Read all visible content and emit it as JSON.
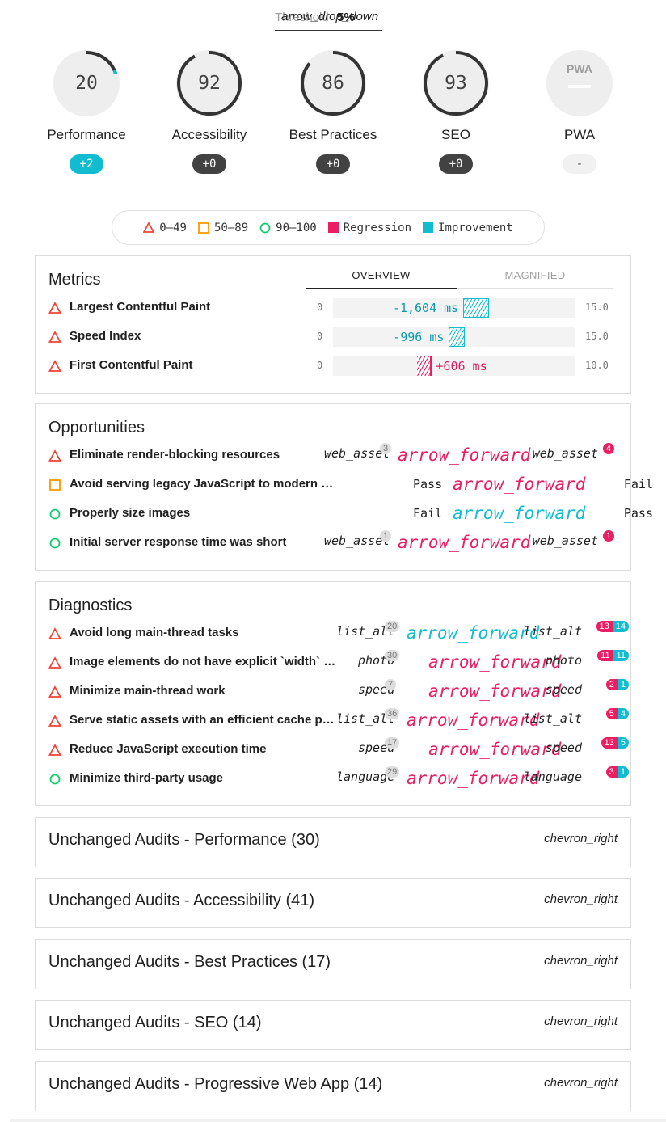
{
  "threshold": {
    "icon": "arrow_drop_down",
    "underlying_label": "Threshold",
    "value": "5%"
  },
  "gauges": [
    {
      "key": "performance",
      "score": "20",
      "label": "Performance",
      "delta": "+2",
      "state": "improve",
      "fraction": 0.2,
      "color": "#12bcd0"
    },
    {
      "key": "accessibility",
      "score": "92",
      "label": "Accessibility",
      "delta": "+0",
      "state": "neutral",
      "fraction": 0.92,
      "color": "#424242"
    },
    {
      "key": "best-practices",
      "score": "86",
      "label": "Best Practices",
      "delta": "+0",
      "state": "neutral",
      "fraction": 0.86,
      "color": "#424242"
    },
    {
      "key": "seo",
      "score": "93",
      "label": "SEO",
      "delta": "+0",
      "state": "neutral",
      "fraction": 0.93,
      "color": "#424242"
    },
    {
      "key": "pwa",
      "score": "",
      "label": "PWA",
      "delta": "-",
      "state": "none",
      "fraction": 0,
      "color": "#bdbdbd",
      "badge_text": "PWA"
    }
  ],
  "legend": {
    "fail": "0–49",
    "average": "50–89",
    "pass": "90–100",
    "regression": "Regression",
    "improvement": "Improvement",
    "colors": {
      "fail": "#f44336",
      "average": "#ff9800",
      "pass": "#0cce6b",
      "regression": "#e91e63",
      "improvement": "#12bcd0"
    }
  },
  "metrics": {
    "title": "Metrics",
    "tabs": {
      "overview": "OVERVIEW",
      "magnified": "MAGNIFIED"
    },
    "rows": [
      {
        "name": "Largest Contentful Paint",
        "min": "0",
        "max": "15.0",
        "value": "-1,604 ms",
        "kind": "improve",
        "start": 8.06,
        "end": 9.66
      },
      {
        "name": "Speed Index",
        "min": "0",
        "max": "15.0",
        "value": "-996 ms",
        "kind": "improve",
        "start": 7.17,
        "end": 8.16
      },
      {
        "name": "First Contentful Paint",
        "min": "0",
        "max": "10.0",
        "value": "+606 ms",
        "kind": "regress",
        "start": 3.47,
        "end": 4.08
      }
    ]
  },
  "opportunities": {
    "title": "Opportunities",
    "rows": [
      {
        "name": "Eliminate render-blocking resources",
        "status": "fail",
        "before": "web_asset",
        "before_badge": "3",
        "arrow": "arrow_forward",
        "arrow_kind": "regress",
        "after": "web_asset",
        "after_badge": "4"
      },
      {
        "name": "Avoid serving legacy JavaScript to modern browsers",
        "status": "average",
        "before": "Pass",
        "arrow": "arrow_forward",
        "arrow_kind": "regress",
        "after": "Fail"
      },
      {
        "name": "Properly size images",
        "status": "pass",
        "before": "Fail",
        "arrow": "arrow_forward",
        "arrow_kind": "improve",
        "after": "Pass"
      },
      {
        "name": "Initial server response time was short",
        "status": "pass",
        "before": "web_asset",
        "before_badge": "1",
        "arrow": "arrow_forward",
        "arrow_kind": "regress",
        "after": "web_asset",
        "after_badge": "1"
      }
    ]
  },
  "diagnostics": {
    "title": "Diagnostics",
    "rows": [
      {
        "name": "Avoid long main-thread tasks",
        "status": "fail",
        "before": "list_alt",
        "before_badge": "20",
        "arrow": "arrow_forward",
        "arrow_kind": "improve",
        "after": "list_alt",
        "after_pink": "13",
        "after_teal": "14"
      },
      {
        "name": "Image elements do not have explicit `width` and `height`",
        "status": "fail",
        "before": "photo",
        "before_badge": "30",
        "arrow": "arrow_forward",
        "arrow_kind": "regress",
        "after": "photo",
        "after_pink": "11",
        "after_teal": "11"
      },
      {
        "name": "Minimize main-thread work",
        "status": "fail",
        "before": "speed",
        "before_badge": "7",
        "arrow": "arrow_forward",
        "arrow_kind": "regress",
        "after": "speed",
        "after_pink": "2",
        "after_teal": "1"
      },
      {
        "name": "Serve static assets with an efficient cache policy",
        "status": "fail",
        "before": "list_alt",
        "before_badge": "36",
        "arrow": "arrow_forward",
        "arrow_kind": "regress",
        "after": "list_alt",
        "after_pink": "5",
        "after_teal": "4"
      },
      {
        "name": "Reduce JavaScript execution time",
        "status": "fail",
        "before": "speed",
        "before_badge": "17",
        "arrow": "arrow_forward",
        "arrow_kind": "regress",
        "after": "speed",
        "after_pink": "13",
        "after_teal": "5"
      },
      {
        "name": "Minimize third-party usage",
        "status": "pass",
        "before": "language",
        "before_badge": "29",
        "arrow": "arrow_forward",
        "arrow_kind": "regress",
        "after": "language",
        "after_pink": "3",
        "after_teal": "1"
      }
    ]
  },
  "unchanged": [
    {
      "label": "Unchanged Audits - Performance (30)",
      "icon": "chevron_right"
    },
    {
      "label": "Unchanged Audits - Accessibility (41)",
      "icon": "chevron_right"
    },
    {
      "label": "Unchanged Audits - Best Practices (17)",
      "icon": "chevron_right"
    },
    {
      "label": "Unchanged Audits - SEO (14)",
      "icon": "chevron_right"
    },
    {
      "label": "Unchanged Audits - Progressive Web App (14)",
      "icon": "chevron_right"
    }
  ]
}
